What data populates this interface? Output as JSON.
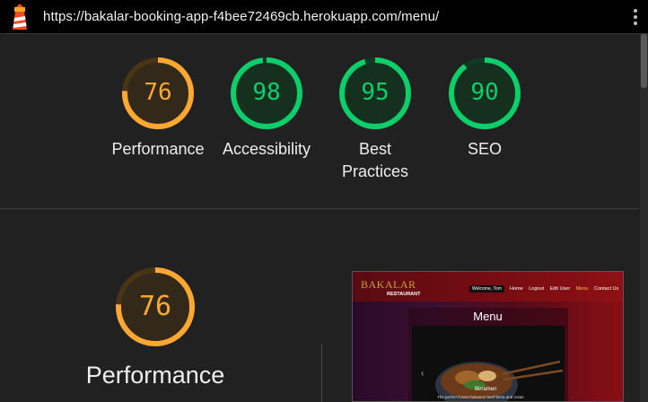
{
  "browser": {
    "url": "https://bakalar-booking-app-f4bee72469cb.herokuapp.com/menu/"
  },
  "scores": [
    {
      "label": "Performance",
      "value": "76",
      "fraction": 0.76,
      "color": "#ffa733"
    },
    {
      "label": "Accessibility",
      "value": "98",
      "fraction": 0.98,
      "color": "#0cce6b"
    },
    {
      "label": "Best Practices",
      "value": "95",
      "fraction": 0.95,
      "color": "#0cce6b"
    },
    {
      "label": "SEO",
      "value": "90",
      "fraction": 0.9,
      "color": "#0cce6b"
    }
  ],
  "detail": {
    "value": "76",
    "fraction": 0.76,
    "label": "Performance",
    "color": "#ffa733"
  },
  "screenshot": {
    "brand": "BAKALAR",
    "brand_sub": "RESTAURANT",
    "welcome": "Welcome, Tom",
    "nav_links": [
      "Home",
      "Logout",
      "Edit User",
      "Menu",
      "Contact Us"
    ],
    "active_link": "Menu",
    "title": "Menu",
    "dish_name": "Birramen",
    "dish_desc": "The perfect fusion between beef birria and Asian"
  },
  "colors": {
    "good": "#0cce6b",
    "average": "#ffa733"
  }
}
